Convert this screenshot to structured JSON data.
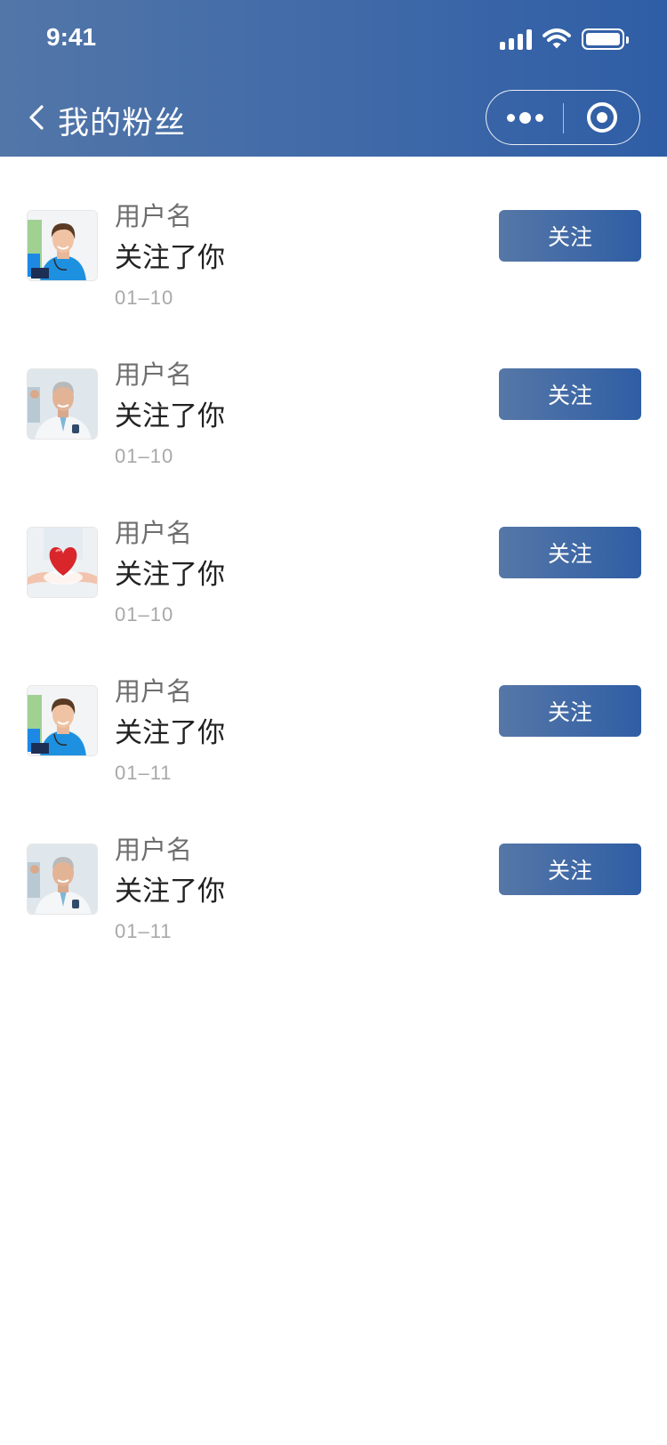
{
  "status_bar": {
    "time": "9:41",
    "icons": [
      "signal-icon",
      "wifi-icon",
      "battery-icon"
    ]
  },
  "nav": {
    "title": "我的粉丝",
    "back_icon": "chevron-left-icon",
    "more_icon": "more-dots-icon",
    "close_icon": "target-circle-icon"
  },
  "colors": {
    "header_start": "#5276a8",
    "header_end": "#2f5ea6",
    "button_start": "#5677a6",
    "button_end": "#2f5ea5"
  },
  "fans": [
    {
      "username": "用户名",
      "action": "关注了你",
      "date": "01–10",
      "button": "关注",
      "avatar": "nurse-avatar"
    },
    {
      "username": "用户名",
      "action": "关注了你",
      "date": "01–10",
      "button": "关注",
      "avatar": "doctor-avatar"
    },
    {
      "username": "用户名",
      "action": "关注了你",
      "date": "01–10",
      "button": "关注",
      "avatar": "heart-hands-avatar"
    },
    {
      "username": "用户名",
      "action": "关注了你",
      "date": "01–11",
      "button": "关注",
      "avatar": "nurse-avatar"
    },
    {
      "username": "用户名",
      "action": "关注了你",
      "date": "01–11",
      "button": "关注",
      "avatar": "doctor-avatar"
    }
  ]
}
